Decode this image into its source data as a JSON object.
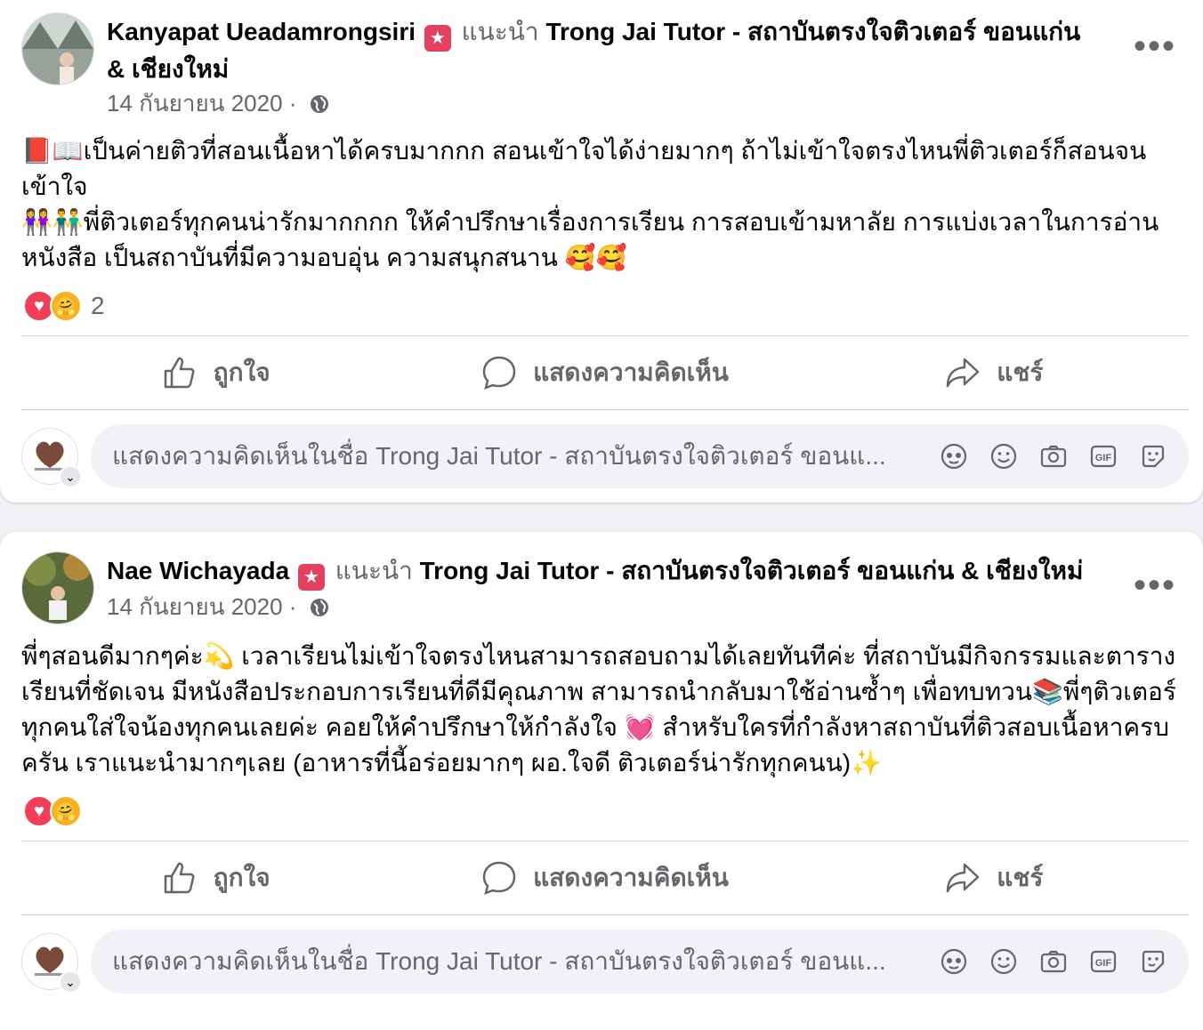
{
  "posts": [
    {
      "author": "Kanyapat Ueadamrongsiri",
      "recommends": "แนะนำ",
      "page_name": "Trong Jai Tutor - สถาบันตรงใจติวเตอร์ ขอนแก่น & เชียงใหม่",
      "date": "14 กันยายน 2020 ·",
      "body": [
        "📕📖เป็นค่ายติวที่สอนเนื้อหาได้ครบมากกก สอนเข้าใจได้ง่ายมากๆ ถ้าไม่เข้าใจตรงไหนพี่ติวเตอร์ก็สอนจนเข้าใจ",
        "👭👬พี่ติวเตอร์ทุกคนน่ารักมากกกก ให้คำปรึกษาเรื่องการเรียน การสอบเข้ามหาลัย การแบ่งเวลาในการอ่านหนังสือ เป็นสถาบันที่มีความอบอุ่น ความสนุกสนาน 🥰🥰"
      ],
      "reaction_count": "2"
    },
    {
      "author": "Nae Wichayada",
      "recommends": "แนะนำ",
      "page_name": "Trong Jai Tutor - สถาบันตรงใจติวเตอร์ ขอนแก่น & เชียงใหม่",
      "date": "14 กันยายน 2020 ·",
      "body": [
        "พี่ๆสอนดีมากๆค่ะ💫 เวลาเรียนไม่เข้าใจตรงไหนสามารถสอบถามได้เลยทันทีค่ะ ที่สถาบันมีกิจกรรมและตารางเรียนที่ชัดเจน มีหนังสือประกอบการเรียนที่ดีมีคุณภาพ สามารถนำกลับมาใช้อ่านซ้ำๆ เพื่อทบทวน📚พี่ๆติวเตอร์ทุกคนใส่ใจน้องทุกคนเลยค่ะ คอยให้คำปรึกษาให้กำลังใจ 💓 สำหรับใครที่กำลังหาสถาบันที่ติวสอบเนื้อหาครบครัน เราแนะนำมากๆเลย (อาหารที่นี้อร่อยมากๆ ผอ.ใจดี ติวเตอร์น่ารักทุกคนน)✨"
      ],
      "reaction_count": ""
    }
  ],
  "actions": {
    "like": "ถูกใจ",
    "comment": "แสดงความคิดเห็น",
    "share": "แชร์"
  },
  "comment_placeholder": "แสดงความคิดเห็นในชื่อ Trong Jai Tutor - สถาบันตรงใจติวเตอร์ ขอนแ...",
  "more_label": "•••",
  "icons": {
    "recommend_badge": "recommend-star-badge",
    "audience": "globe-icon",
    "reactions": [
      "love-reaction-icon",
      "care-reaction-icon"
    ],
    "action_icons": [
      "like-thumb-icon",
      "comment-bubble-icon",
      "share-arrow-icon"
    ],
    "comment_tools": [
      "avatar-sticker-icon",
      "emoji-icon",
      "camera-icon",
      "gif-icon",
      "sticker-icon"
    ]
  },
  "colors": {
    "badge": "#e4405f",
    "secondary_text": "#65676b",
    "love": "#f33e58",
    "care": "#f7b125"
  }
}
